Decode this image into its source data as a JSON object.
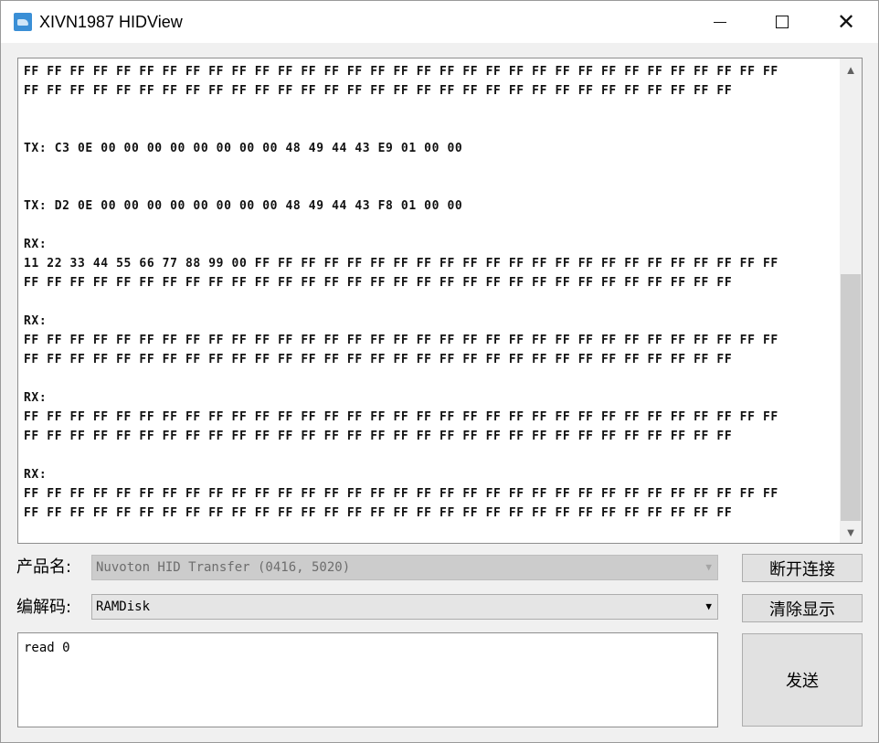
{
  "window": {
    "title": "XIVN1987 HIDView",
    "controls": {
      "minimize": "minimize-icon",
      "maximize": "maximize-icon",
      "close": "close-icon"
    }
  },
  "output": {
    "lines": [
      "FF FF FF FF FF FF FF FF FF FF FF FF FF FF FF FF FF FF FF FF FF FF FF FF FF FF FF FF FF FF FF FF FF",
      "FF FF FF FF FF FF FF FF FF FF FF FF FF FF FF FF FF FF FF FF FF FF FF FF FF FF FF FF FF FF FF",
      "",
      "",
      "TX: C3 0E 00 00 00 00 00 00 00 00 48 49 44 43 E9 01 00 00",
      "",
      "",
      "TX: D2 0E 00 00 00 00 00 00 00 00 48 49 44 43 F8 01 00 00",
      "",
      "RX:",
      "11 22 33 44 55 66 77 88 99 00 FF FF FF FF FF FF FF FF FF FF FF FF FF FF FF FF FF FF FF FF FF FF FF",
      "FF FF FF FF FF FF FF FF FF FF FF FF FF FF FF FF FF FF FF FF FF FF FF FF FF FF FF FF FF FF FF",
      "",
      "RX:",
      "FF FF FF FF FF FF FF FF FF FF FF FF FF FF FF FF FF FF FF FF FF FF FF FF FF FF FF FF FF FF FF FF FF",
      "FF FF FF FF FF FF FF FF FF FF FF FF FF FF FF FF FF FF FF FF FF FF FF FF FF FF FF FF FF FF FF",
      "",
      "RX:",
      "FF FF FF FF FF FF FF FF FF FF FF FF FF FF FF FF FF FF FF FF FF FF FF FF FF FF FF FF FF FF FF FF FF",
      "FF FF FF FF FF FF FF FF FF FF FF FF FF FF FF FF FF FF FF FF FF FF FF FF FF FF FF FF FF FF FF",
      "",
      "RX:",
      "FF FF FF FF FF FF FF FF FF FF FF FF FF FF FF FF FF FF FF FF FF FF FF FF FF FF FF FF FF FF FF FF FF",
      "FF FF FF FF FF FF FF FF FF FF FF FF FF FF FF FF FF FF FF FF FF FF FF FF FF FF FF FF FF FF FF"
    ]
  },
  "product": {
    "label": "产品名:",
    "value": "Nuvoton HID Transfer (0416, 5020)"
  },
  "codec": {
    "label": "编解码:",
    "value": "RAMDisk"
  },
  "buttons": {
    "disconnect": "断开连接",
    "clear": "清除显示",
    "send": "发送"
  },
  "input": {
    "value": "read 0"
  },
  "colors": {
    "accent": "#3a8fd6",
    "thumb": "#cdcdcd"
  }
}
